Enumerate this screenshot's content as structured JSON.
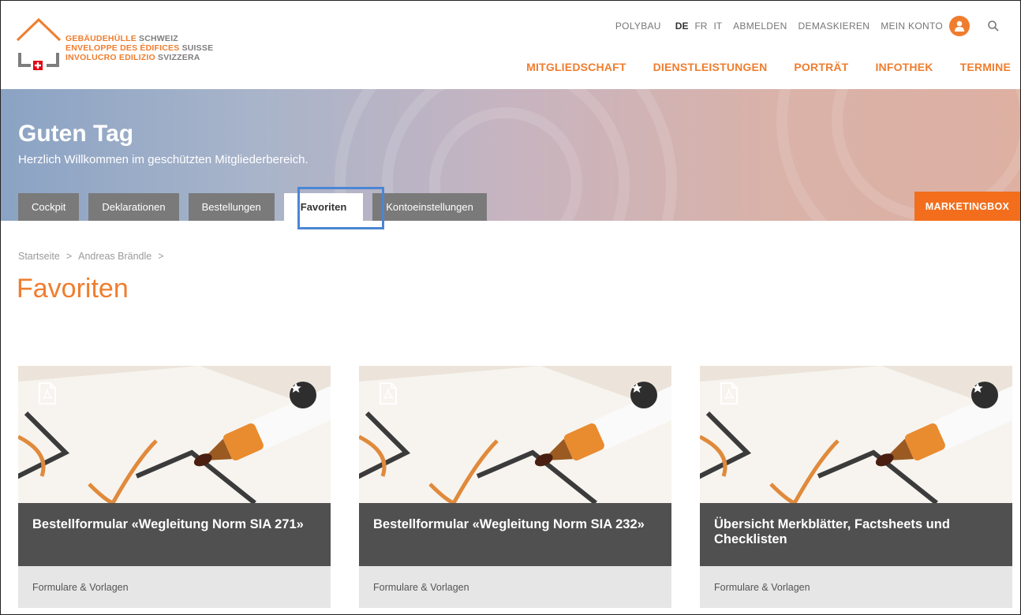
{
  "logo": {
    "line1_a": "GEBÄUDEHÜLLE",
    "line1_b": "SCHWEIZ",
    "line2_a": "ENVELOPPE DES ÉDIFICES",
    "line2_b": "SUISSE",
    "line3_a": "INVOLUCRO EDILIZIO",
    "line3_b": "SVIZZERA"
  },
  "utility": {
    "polybau": "POLYBAU",
    "languages": [
      "DE",
      "FR",
      "IT"
    ],
    "active_language": "DE",
    "abmelden": "ABMELDEN",
    "demaskieren": "DEMASKIEREN",
    "mein_konto": "MEIN KONTO"
  },
  "mainnav": [
    "MITGLIEDSCHAFT",
    "DIENSTLEISTUNGEN",
    "PORTRÄT",
    "INFOTHEK",
    "TERMINE"
  ],
  "hero": {
    "title": "Guten Tag",
    "subtitle": "Herzlich Willkommen im geschützten Mitgliederbereich."
  },
  "tabs": [
    "Cockpit",
    "Deklarationen",
    "Bestellungen",
    "Favoriten",
    "Kontoeinstellungen"
  ],
  "active_tab": "Favoriten",
  "marketing_button": "MARKETINGBOX",
  "breadcrumb": [
    "Startseite",
    "Andreas Brändle"
  ],
  "breadcrumb_separator": ">",
  "page_title": "Favoriten",
  "cards": [
    {
      "title": "Bestellformular «Wegleitung Norm SIA 271»",
      "category": "Formulare & Vorlagen"
    },
    {
      "title": "Bestellformular «Wegleitung Norm SIA 232»",
      "category": "Formulare & Vorlagen"
    },
    {
      "title": "Übersicht Merkblätter, Factsheets und Checklisten",
      "category": "Formulare & Vorlagen"
    }
  ],
  "colors": {
    "brand_orange": "#ef7d2e",
    "marketing_orange": "#f26e1d",
    "tab_gray": "#7a7a7a",
    "card_title_bg": "#505050",
    "highlight_blue": "#4a86d4"
  }
}
